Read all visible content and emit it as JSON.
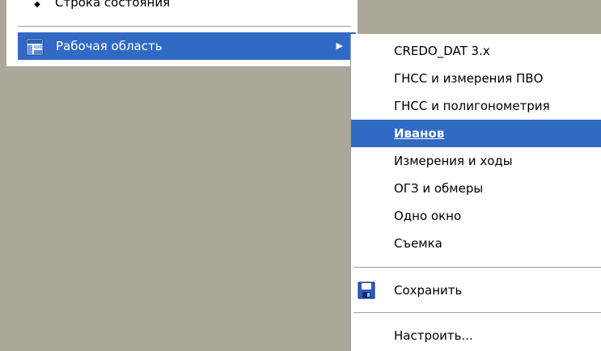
{
  "main_menu": {
    "status_bar_item": "Строка состояния",
    "workspace_item": "Рабочая область",
    "submenu_arrow": "▶"
  },
  "workspace_submenu": {
    "items": [
      "CREDO_DAT 3.x",
      "ГНСС и измерения ПВО",
      "ГНСС и полигонометрия",
      "Иванов",
      "Измерения и ходы",
      "ОГЗ и обмеры",
      "Одно окно",
      "Съемка"
    ],
    "active_item": "Иванов",
    "save": "Сохранить",
    "configure": "Настроить..."
  },
  "colors": {
    "highlight": "#316ac5",
    "desktop": "#aca899"
  }
}
